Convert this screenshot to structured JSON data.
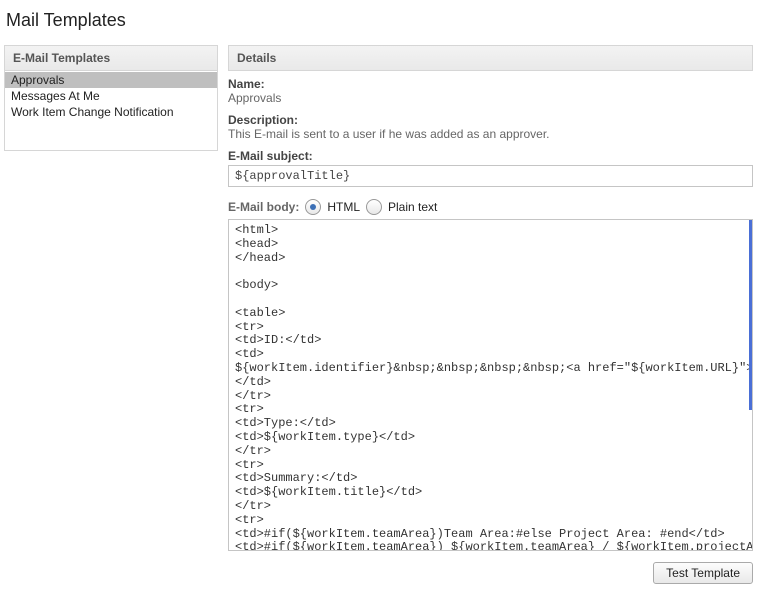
{
  "pageTitle": "Mail Templates",
  "leftPanel": {
    "header": "E-Mail Templates",
    "items": [
      {
        "label": "Approvals",
        "selected": true
      },
      {
        "label": "Messages At Me",
        "selected": false
      },
      {
        "label": "Work Item Change Notification",
        "selected": false
      }
    ]
  },
  "details": {
    "header": "Details",
    "nameLabel": "Name:",
    "nameValue": "Approvals",
    "descriptionLabel": "Description:",
    "descriptionValue": "This E-mail is sent to a user if he was added as an approver.",
    "subjectLabel": "E-Mail subject:",
    "subjectValue": "${approvalTitle}",
    "bodyLabel": "E-Mail body:",
    "formatHtml": "HTML",
    "formatPlain": "Plain text",
    "bodyValue": "<html>\n<head>\n</head>\n\n<body>\n\n<table>\n<tr>\n<td>ID:</td>\n<td>\n${workItem.identifier}&nbsp;&nbsp;&nbsp;&nbsp;<a href=\"${workItem.URL}\">Open in web browser</a>\n</td>\n</tr>\n<tr>\n<td>Type:</td>\n<td>${workItem.type}</td>\n</tr>\n<tr>\n<td>Summary:</td>\n<td>${workItem.title}</td>\n</tr>\n<tr>\n<td>#if(${workItem.teamArea})Team Area:#else Project Area: #end</td>\n<td>#if(${workItem.teamArea}) ${workItem.teamArea} / ${workItem.projectArea}#else",
    "testButton": "Test Template"
  }
}
